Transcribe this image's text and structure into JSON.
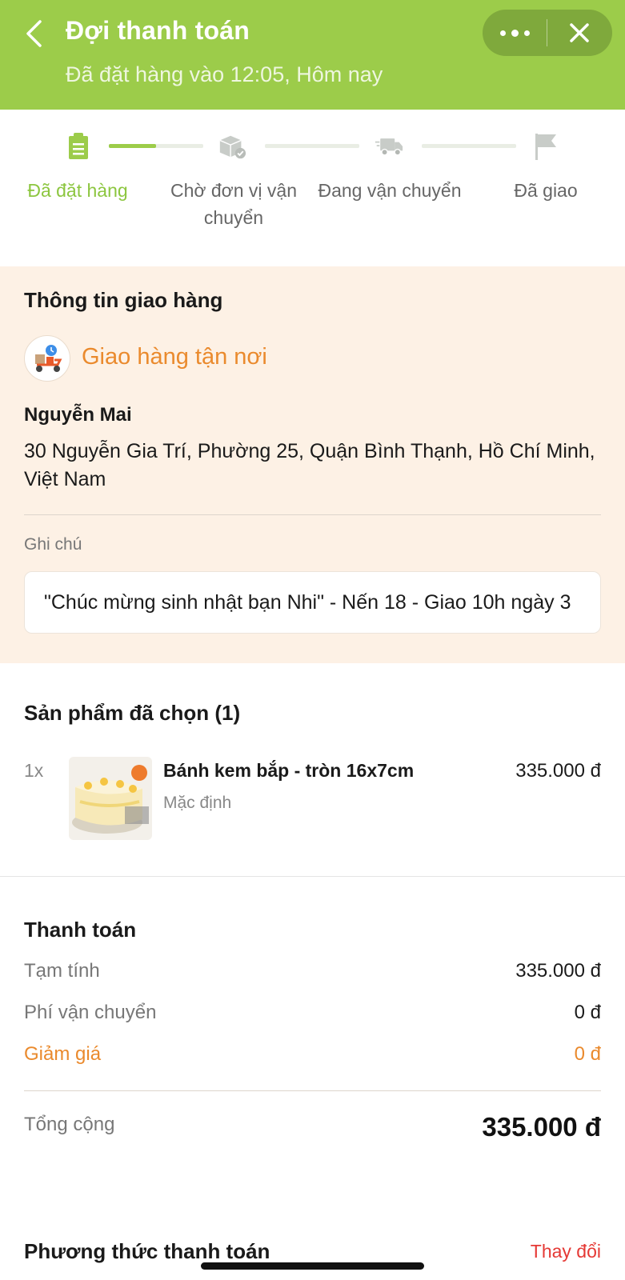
{
  "header": {
    "title": "Đợi thanh toán",
    "subtitle": "Đã đặt hàng vào 12:05, Hôm nay",
    "back_icon": "chevron-left-icon",
    "more_icon": "more-dots-icon",
    "close_icon": "close-icon",
    "bg_color": "#9ccc4a"
  },
  "stepper": {
    "progress": 0.5,
    "steps": [
      {
        "label": "Đã đặt hàng",
        "icon": "clipboard-icon",
        "active": true
      },
      {
        "label": "Chờ đơn vị vận chuyển",
        "icon": "package-check-icon",
        "active": false
      },
      {
        "label": "Đang vận chuyển",
        "icon": "truck-icon",
        "active": false
      },
      {
        "label": "Đã giao",
        "icon": "flag-icon",
        "active": false
      }
    ]
  },
  "delivery": {
    "title": "Thông tin giao hàng",
    "method": "Giao hàng tận nơi",
    "method_icon": "delivery-scooter-icon",
    "name": "Nguyễn Mai",
    "address": "30 Nguyễn Gia Trí, Phường 25, Quận Bình Thạnh, Hồ Chí Minh, Việt Nam",
    "note_label": "Ghi chú",
    "note_value": "\"Chúc mừng sinh nhật bạn Nhi\" - Nến 18 - Giao 10h ngày 3"
  },
  "products": {
    "title": "Sản phẩm đã chọn (1)",
    "items": [
      {
        "qty": "1x",
        "name": "Bánh kem bắp - tròn 16x7cm",
        "variant": "Mặc định",
        "price": "335.000 đ",
        "image": "corn-cake-image"
      }
    ]
  },
  "payment": {
    "title": "Thanh toán",
    "subtotal_label": "Tạm tính",
    "subtotal_value": "335.000 đ",
    "shipping_label": "Phí vận chuyển",
    "shipping_value": "0 đ",
    "discount_label": "Giảm giá",
    "discount_value": "0 đ",
    "total_label": "Tổng cộng",
    "total_value": "335.000 đ"
  },
  "payment_method": {
    "title": "Phương thức thanh toán",
    "change_label": "Thay đổi"
  },
  "colors": {
    "accent_green": "#9ccc4a",
    "accent_orange": "#ea8a2d",
    "link_red": "#e53935",
    "delivery_bg": "#fdf1e5"
  }
}
